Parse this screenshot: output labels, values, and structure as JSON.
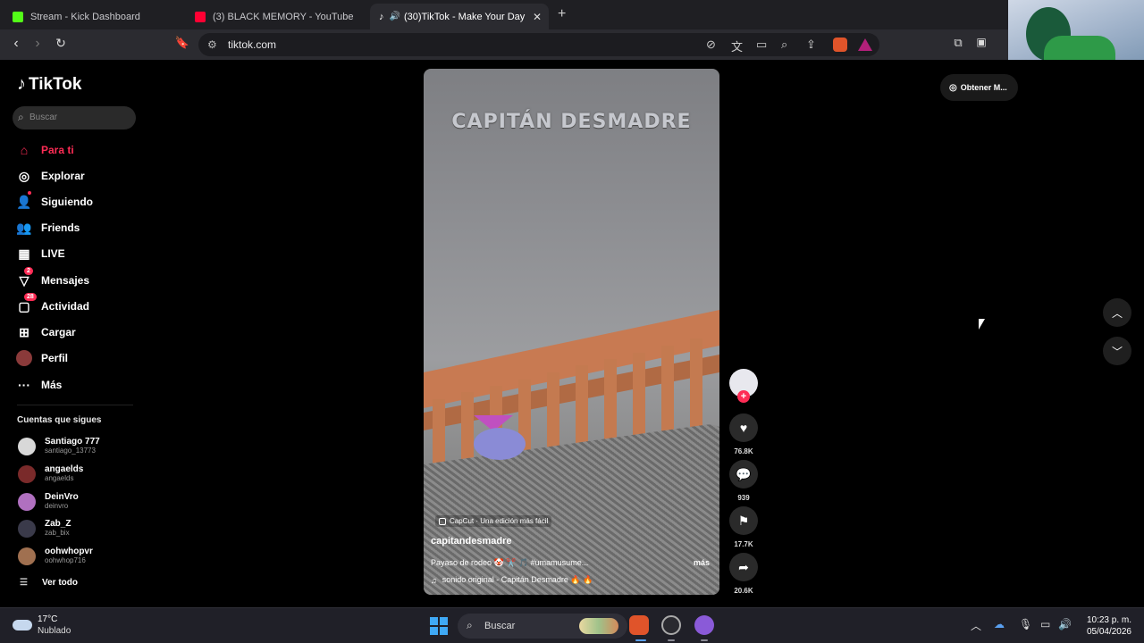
{
  "browser": {
    "tabs": [
      {
        "title": "Stream - Kick Dashboard",
        "favicon_color": "#53fc18"
      },
      {
        "title": "(3) BLACK MEMORY - YouTube",
        "favicon_color": "#ff0033"
      },
      {
        "title": "(30)TikTok - Make Your Day",
        "favicon_color": "#111111",
        "active": true
      }
    ],
    "url": "tiktok.com"
  },
  "sidebar": {
    "logo": "TikTok",
    "search_placeholder": "Buscar",
    "nav": [
      {
        "label": "Para ti",
        "icon": "home-icon",
        "active": true
      },
      {
        "label": "Explorar",
        "icon": "compass-icon"
      },
      {
        "label": "Siguiendo",
        "icon": "following-icon"
      },
      {
        "label": "Friends",
        "icon": "friends-icon"
      },
      {
        "label": "LIVE",
        "icon": "live-icon"
      },
      {
        "label": "Mensajes",
        "icon": "messages-icon",
        "badge": "2"
      },
      {
        "label": "Actividad",
        "icon": "activity-icon",
        "badge": "28"
      },
      {
        "label": "Cargar",
        "icon": "upload-icon"
      },
      {
        "label": "Perfil",
        "icon": "profile-icon"
      },
      {
        "label": "Más",
        "icon": "more-icon"
      }
    ],
    "following_title": "Cuentas que sigues",
    "following": [
      {
        "name": "Santiago 777",
        "handle": "santiago_13773",
        "color": "#d8d8d8"
      },
      {
        "name": "angaelds",
        "handle": "angaelds",
        "color": "#7a2a2a"
      },
      {
        "name": "DeinVro",
        "handle": "deinvro",
        "color": "#b070c0"
      },
      {
        "name": "Zab_Z",
        "handle": "zab_bix",
        "color": "#3a3a4a"
      },
      {
        "name": "oohwhopvr",
        "handle": "oohwhop716",
        "color": "#a07050"
      }
    ],
    "see_all": "Ver todo"
  },
  "video": {
    "title_overlay": "CAPITÁN DESMADRE",
    "capcut_label": "CapCut · Una edición más fácil",
    "author": "capitandesmadre",
    "description": "Payaso de rodeo 🤡 ✂️ 🎵 #umamusume...",
    "more": "más",
    "sound": "sonido original - Capitán Desmadre 🔥 🔥"
  },
  "actions": {
    "likes": "76.8K",
    "comments": "939",
    "saves": "17.7K",
    "shares": "20.6K"
  },
  "get_app": "Obtener M...",
  "taskbar": {
    "temp": "17°C",
    "condition": "Nublado",
    "search": "Buscar",
    "time": "10:23 p. m.",
    "date": "05/04/2026"
  }
}
